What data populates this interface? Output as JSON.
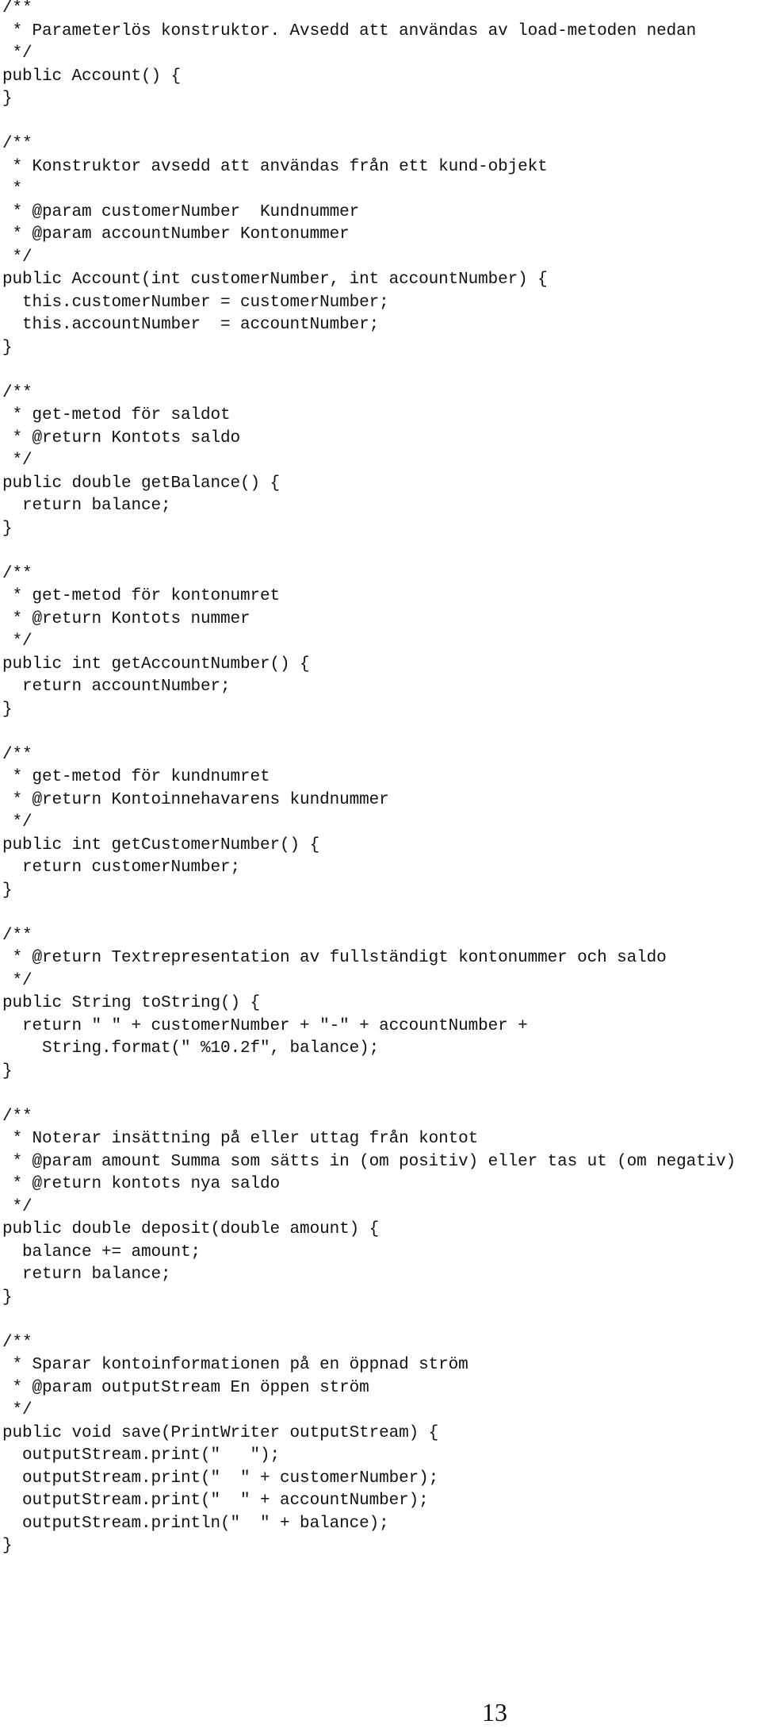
{
  "code_lines": [
    "/**",
    " * Parameterlös konstruktor. Avsedd att användas av load-metoden nedan",
    " */",
    "public Account() {",
    "}",
    "",
    "/**",
    " * Konstruktor avsedd att användas från ett kund-objekt",
    " *",
    " * @param customerNumber  Kundnummer",
    " * @param accountNumber Kontonummer",
    " */",
    "public Account(int customerNumber, int accountNumber) {",
    "  this.customerNumber = customerNumber;",
    "  this.accountNumber  = accountNumber;",
    "}",
    "",
    "/**",
    " * get-metod för saldot",
    " * @return Kontots saldo",
    " */",
    "public double getBalance() {",
    "  return balance;",
    "}",
    "",
    "/**",
    " * get-metod för kontonumret",
    " * @return Kontots nummer",
    " */",
    "public int getAccountNumber() {",
    "  return accountNumber;",
    "}",
    "",
    "/**",
    " * get-metod för kundnumret",
    " * @return Kontoinnehavarens kundnummer",
    " */",
    "public int getCustomerNumber() {",
    "  return customerNumber;",
    "}",
    "",
    "/**",
    " * @return Textrepresentation av fullständigt kontonummer och saldo",
    " */",
    "public String toString() {",
    "  return \" \" + customerNumber + \"-\" + accountNumber +",
    "    String.format(\" %10.2f\", balance);",
    "}",
    "",
    "/**",
    " * Noterar insättning på eller uttag från kontot",
    " * @param amount Summa som sätts in (om positiv) eller tas ut (om negativ)",
    " * @return kontots nya saldo",
    " */",
    "public double deposit(double amount) {",
    "  balance += amount;",
    "  return balance;",
    "}",
    "",
    "/**",
    " * Sparar kontoinformationen på en öppnad ström",
    " * @param outputStream En öppen ström",
    " */",
    "public void save(PrintWriter outputStream) {",
    "  outputStream.print(\"   \");",
    "  outputStream.print(\"  \" + customerNumber);",
    "  outputStream.print(\"  \" + accountNumber);",
    "  outputStream.println(\"  \" + balance);",
    "}"
  ],
  "page_number": "13"
}
